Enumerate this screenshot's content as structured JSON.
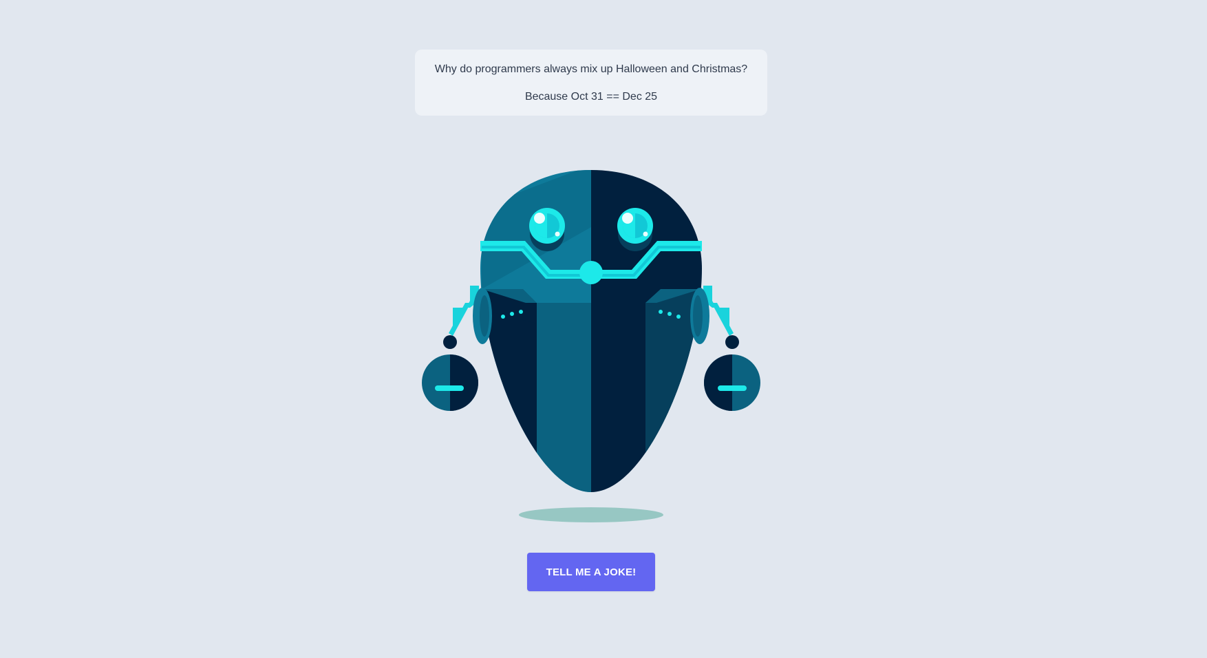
{
  "joke": {
    "setup": "Why do programmers always mix up Halloween and Christmas?",
    "punchline": "Because Oct 31 == Dec 25"
  },
  "actions": {
    "tell_joke_label": "TELL ME A JOKE!"
  },
  "robot": {
    "icon": "robot-illustration",
    "colors": {
      "teal_light": "#0e7a9a",
      "teal_mid": "#0b6280",
      "teal_dark": "#063f5c",
      "navy": "#01203e",
      "cyan": "#1de9e9",
      "shadow": "#97c7c3"
    }
  },
  "theme": {
    "background": "#e1e7ef",
    "card": "#eef2f7",
    "button": "#6366f1"
  }
}
